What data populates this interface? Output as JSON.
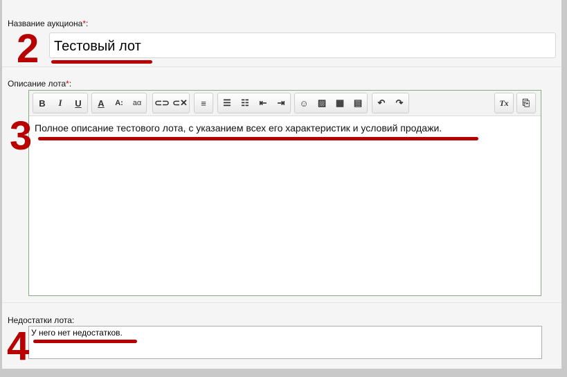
{
  "auction_name": {
    "label": "Название аукциона",
    "required": "*",
    "colon": ":",
    "value": "Тестовый лот",
    "step": "2"
  },
  "description": {
    "label": "Описание лота",
    "required": "*",
    "colon": ":",
    "value": "Полное описание тестового лота, с указанием всех его характеристик и условий продажи.",
    "step": "3",
    "toolbar": {
      "bold": "B",
      "italic": "I",
      "underline": "U",
      "text_color": "A",
      "font_size": "A:",
      "subscript": "aα",
      "remove_format": "Tx"
    }
  },
  "defects": {
    "label": "Недостатки лота:",
    "value": "У него нет недостатков.",
    "step": "4"
  }
}
